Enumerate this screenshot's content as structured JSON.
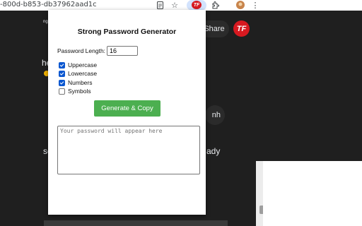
{
  "browser": {
    "url_fragment": "-800d-b853-db37962aad1c",
    "partial_tab_text": "ng",
    "icons": [
      "document-icon",
      "star-icon",
      "extension-logo-icon",
      "puzzle-icon",
      "profile-avatar",
      "kebab-menu-icon"
    ]
  },
  "background_page": {
    "share_label": "Share",
    "logo_letters": "TF",
    "left_texts": [
      "he",
      "se"
    ],
    "right_texts": [
      "nh",
      "ady"
    ],
    "colors": {
      "background": "#1f1f1f",
      "panel": "#ffffff"
    }
  },
  "popup": {
    "title": "Strong Password Generator",
    "length_label": "Password Length:",
    "length_value": "16",
    "options": [
      {
        "label": "Uppercase",
        "checked": true
      },
      {
        "label": "Lowercase",
        "checked": true
      },
      {
        "label": "Numbers",
        "checked": true
      },
      {
        "label": "Symbols",
        "checked": false
      }
    ],
    "generate_label": "Generate & Copy",
    "output_placeholder": "Your password will appear here",
    "colors": {
      "button": "#4caf50",
      "checkbox": "#0b57d0"
    }
  }
}
